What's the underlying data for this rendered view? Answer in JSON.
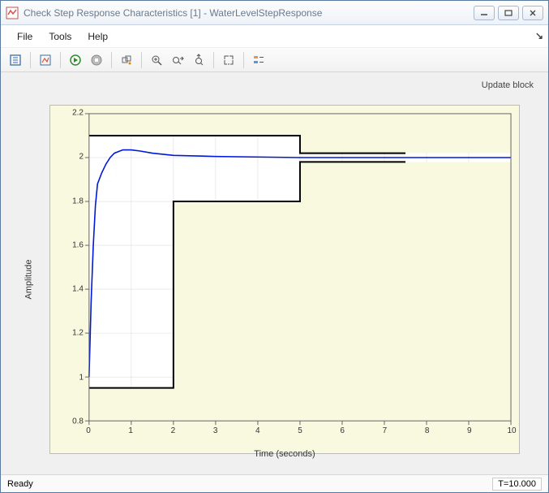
{
  "window": {
    "title": "Check Step Response Characteristics [1] - WaterLevelStepResponse"
  },
  "menu": {
    "file": "File",
    "tools": "Tools",
    "help": "Help"
  },
  "link": {
    "update": "Update block"
  },
  "status": {
    "ready": "Ready",
    "time": "T=10.000"
  },
  "axis": {
    "xlabel": "Time (seconds)",
    "ylabel": "Amplitude"
  },
  "ticks": {
    "x": [
      "0",
      "1",
      "2",
      "3",
      "4",
      "5",
      "6",
      "7",
      "8",
      "9",
      "10"
    ],
    "y": [
      "0.8",
      "1",
      "1.2",
      "1.4",
      "1.6",
      "1.8",
      "2",
      "2.2"
    ]
  },
  "chart_data": {
    "type": "line",
    "xlabel": "Time (seconds)",
    "ylabel": "Amplitude",
    "xlim": [
      0,
      10
    ],
    "ylim": [
      0.8,
      2.2
    ],
    "series": [
      {
        "name": "response",
        "x": [
          0,
          0.05,
          0.1,
          0.15,
          0.2,
          0.3,
          0.4,
          0.5,
          0.6,
          0.8,
          1.0,
          1.2,
          1.5,
          2.0,
          3.0,
          5.0,
          10.0
        ],
        "values": [
          1.0,
          1.35,
          1.6,
          1.78,
          1.88,
          1.93,
          1.97,
          2.0,
          2.02,
          2.035,
          2.035,
          2.03,
          2.02,
          2.01,
          2.005,
          2.0,
          2.0
        ]
      }
    ],
    "bounds": {
      "upper": [
        [
          0,
          2.1
        ],
        [
          5,
          2.1
        ],
        [
          5,
          2.02
        ],
        [
          7.5,
          2.02
        ]
      ],
      "lower": [
        [
          0,
          0.95
        ],
        [
          2,
          0.95
        ],
        [
          2,
          1.8
        ],
        [
          5,
          1.8
        ],
        [
          5,
          1.98
        ],
        [
          7.5,
          1.98
        ]
      ]
    }
  }
}
